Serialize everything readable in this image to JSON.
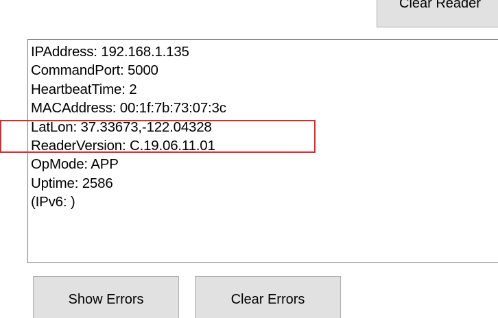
{
  "toolbar": {
    "top_button_label": "Clear Reader"
  },
  "reader_info": {
    "lines": [
      "IPAddress: 192.168.1.135",
      "CommandPort: 5000",
      "HeartbeatTime: 2",
      "MACAddress: 00:1f:7b:73:07:3c",
      "LatLon: 37.33673,-122.04328",
      "ReaderVersion: C.19.06.11.01",
      "OpMode: APP",
      "Uptime: 2586",
      "(IPv6: )"
    ]
  },
  "errors": {
    "show_label": "Show Errors",
    "clear_label": "Clear Errors"
  },
  "colors": {
    "highlight": "#e0282e",
    "button_face": "#e1e1e1",
    "button_border": "#adadad",
    "textbox_border": "#7a7a7a"
  }
}
